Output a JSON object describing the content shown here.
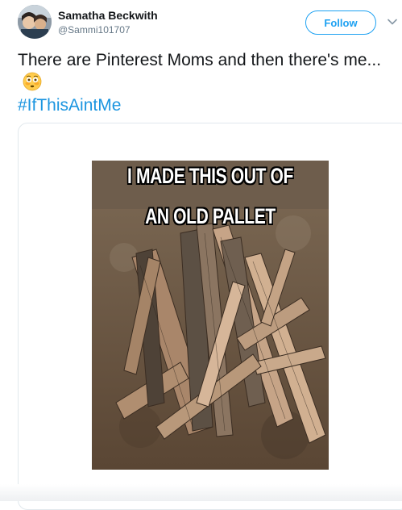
{
  "tweet": {
    "display_name": "Samatha Beckwith",
    "handle": "@Sammi101707",
    "follow_label": "Follow",
    "text": "There are Pinterest Moms and then there's me...",
    "emoji": "flushed-face",
    "hashtag": "#IfThisAintMe"
  },
  "media": {
    "caption_line1": "I MADE THIS OUT OF",
    "caption_line2": "AN OLD PALLET"
  },
  "colors": {
    "accent": "#1da1f2",
    "hashtag": "#1b95e0",
    "text": "#14171a",
    "muted": "#657786"
  }
}
